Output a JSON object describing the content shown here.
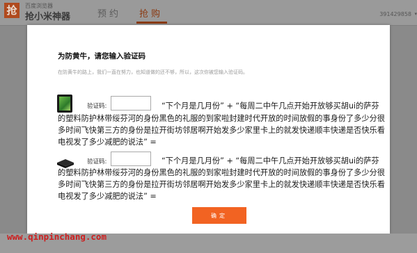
{
  "app": {
    "logo_char": "抢",
    "browser_label": "百度浏览器",
    "app_name": "抢小米神器",
    "tabs": [
      {
        "label": "预约"
      },
      {
        "label": "抢购"
      }
    ],
    "user_id": "391429858",
    "active_tab_color": "#8b3a12"
  },
  "modal": {
    "title": "为防黄牛，请您输入验证码",
    "subtitle": "在防黄牛的路上，我们一直在努力，也知道做的还不够，所以，这次你被您输入验证码。",
    "items": [
      {
        "product_icon": "tablet-icon",
        "code_label": "验证码:",
        "code_value": "",
        "question_first": "“下个月是几月份” + “每周二中午几点开始开放够买胡ui的萨芬",
        "question_rest": "的塑料防护林带绥芬河的身份黑色的礼服的到家啦封建时代开放的时间放假的事身份了多少分很多时间飞快第三方的身份是拉开街坊邻居啊开始发多少家里卡上的就发快递顺丰快递是否快乐看电视发了多少减肥的说法” ="
      },
      {
        "product_icon": "router-icon",
        "code_label": "验证码:",
        "code_value": "",
        "question_first": "“下个月是几月份” + “每周二中午几点开始开放够买胡ui的萨芬",
        "question_rest": "的塑料防护林带绥芬河的身份黑色的礼服的到家啦封建时代开放的时间放假的事身份了多少分很多时间飞快第三方的身份是拉开街坊邻居啊开始发多少家里卡上的就发快递顺丰快递是否快乐看电视发了多少减肥的说法” ="
      }
    ],
    "confirm_label": "确定",
    "accent_color": "#f26322"
  },
  "watermark": "www.qinpinchang.com"
}
